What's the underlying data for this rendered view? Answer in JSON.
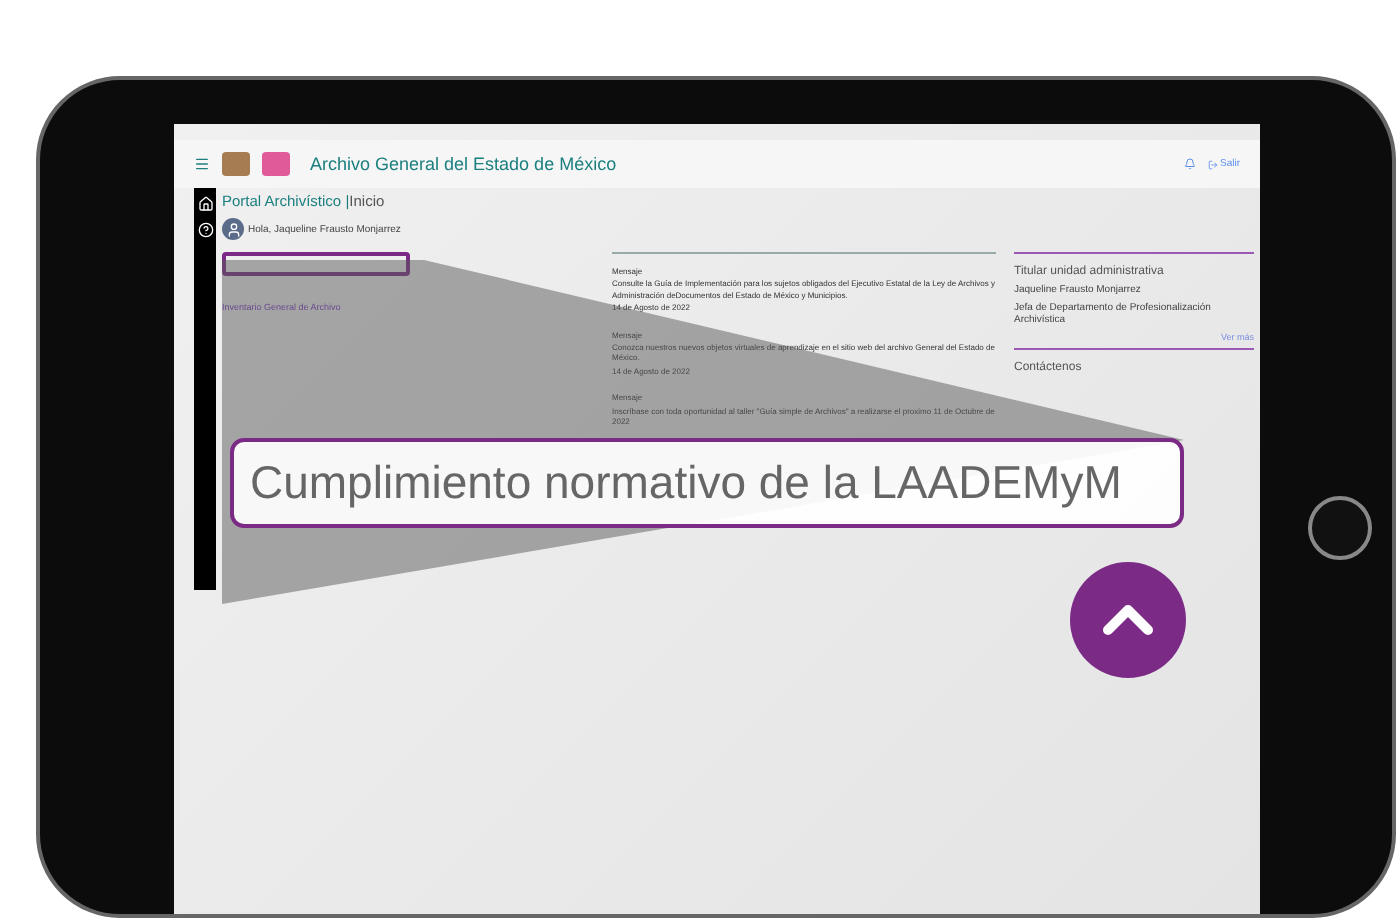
{
  "header": {
    "title": "Archivo General del Estado de México",
    "logout": "Salir"
  },
  "breadcrumb": {
    "section": "Portal Archivístico",
    "separator": "|",
    "page": "Inicio"
  },
  "greeting": "Hola, Jaqueline Frausto Monjarrez",
  "left_links": [
    "Inventario General de Archivo"
  ],
  "messages": [
    {
      "label": "Mensaje",
      "text": "Consulte la Guía de Implementación para los sujetos obligados del Ejecutivo Estatal de la Ley de Archivos y Administración deDocumentos del Estado de México y Municipios.",
      "date": "14 de Agosto de 2022"
    },
    {
      "label": "Mensaje",
      "text": "Conozca nuestros nuevos objetos virtuales de aprendizaje en el sitio web del archivo General del Estado de México.",
      "date": "14 de Agosto de 2022"
    },
    {
      "label": "Mensaje",
      "text": "Inscríbase con toda oportunidad al taller \"Guía simple de Archivos\" a realizarse el proximo 11 de Octubre de 2022"
    }
  ],
  "titular": {
    "heading": "Titular unidad administrativa",
    "name": "Jaqueline Frausto Monjarrez",
    "role": "Jefa de Departamento de Profesionalización Archivística",
    "more": "Ver más"
  },
  "contact": {
    "heading": "Contáctenos"
  },
  "callout": "Cumplimiento normativo de la LAADEMyM"
}
